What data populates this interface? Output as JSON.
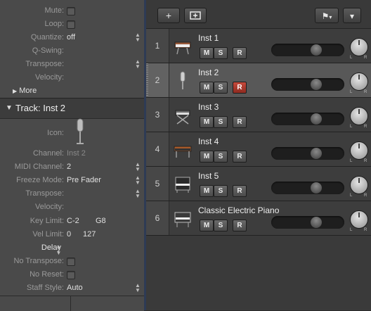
{
  "region_params": [
    {
      "label": "Mute:",
      "type": "checkbox"
    },
    {
      "label": "Loop:",
      "type": "checkbox"
    },
    {
      "label": "Quantize:",
      "value": "off",
      "stepper": true
    },
    {
      "label": "Q-Swing:",
      "value": ""
    },
    {
      "label": "Transpose:",
      "value": "",
      "stepper": true
    },
    {
      "label": "Velocity:",
      "value": ""
    }
  ],
  "more_label": "More",
  "track_inspector": {
    "title": "Track:  Inst 2",
    "icon_label": "Icon:",
    "params": [
      {
        "label": "Channel:",
        "value": "Inst 2",
        "dim": true
      },
      {
        "label": "MIDI Channel:",
        "value": "2",
        "stepper": true
      },
      {
        "label": "Freeze Mode:",
        "value": "Pre Fader",
        "stepper": true
      },
      {
        "label": "Transpose:",
        "value": "",
        "stepper": true
      },
      {
        "label": "Velocity:",
        "value": ""
      },
      {
        "label": "Key Limit:",
        "value": "C-2",
        "value2": "G8"
      },
      {
        "label": "Vel Limit:",
        "value": "0",
        "value2": "127"
      },
      {
        "label": "Delay",
        "value": "",
        "delay": true
      },
      {
        "label": "No Transpose:",
        "type": "checkbox"
      },
      {
        "label": "No Reset:",
        "type": "checkbox"
      },
      {
        "label": "Staff Style:",
        "value": "Auto",
        "stepper": true
      }
    ]
  },
  "toolbar": {
    "add": "+",
    "add_folder": "+",
    "flag": "⚑",
    "menu": "▾"
  },
  "tracks": [
    {
      "number": "1",
      "name": "Inst 1",
      "icon": "synth-keyboard-icon",
      "selected": false,
      "record": false
    },
    {
      "number": "2",
      "name": "Inst 2",
      "icon": "microphone-icon",
      "selected": true,
      "record": true
    },
    {
      "number": "3",
      "name": "Inst 3",
      "icon": "keyboard-stand-icon",
      "selected": false,
      "record": false
    },
    {
      "number": "4",
      "name": "Inst 4",
      "icon": "synth-stand-icon",
      "selected": false,
      "record": false
    },
    {
      "number": "5",
      "name": "Inst 5",
      "icon": "upright-piano-icon",
      "selected": false,
      "record": false
    },
    {
      "number": "6",
      "name": "Classic Electric Piano",
      "icon": "electric-piano-icon",
      "selected": false,
      "record": false
    }
  ],
  "button_labels": {
    "mute": "M",
    "solo": "S",
    "record": "R"
  },
  "pan_labels": {
    "left": "L",
    "right": "R"
  },
  "colors": {
    "record_active": "#b8392c",
    "selected_row": "#585858",
    "divider": "#2e3b55"
  }
}
